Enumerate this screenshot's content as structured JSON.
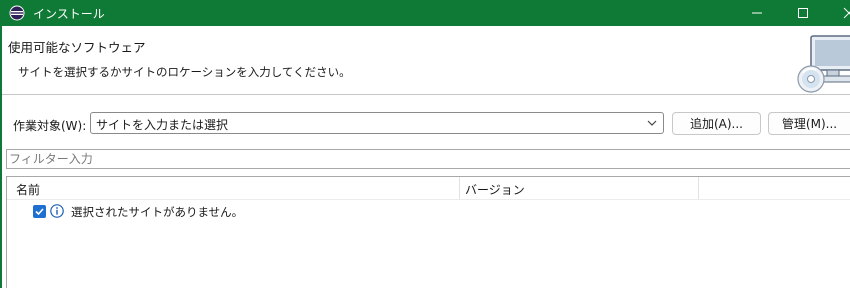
{
  "window": {
    "title": "インストール",
    "icons": {
      "app": "eclipse-icon",
      "minimize": "minimize-icon",
      "maximize": "maximize-icon",
      "close": "close-icon"
    },
    "colors": {
      "titlebar": "#0f7a36",
      "titlebar_text": "#ffffff"
    }
  },
  "banner": {
    "heading": "使用可能なソフトウェア",
    "message": "サイトを選択するかサイトのロケーションを入力してください。",
    "graphic": "computer-cd-install-icon"
  },
  "work_with": {
    "label": "作業対象(W):",
    "combo_value": "サイトを入力または選択",
    "add_button": "追加(A)...",
    "manage_button": "管理(M)..."
  },
  "filter": {
    "placeholder": "フィルター入力",
    "value": ""
  },
  "table": {
    "columns": [
      "名前",
      "バージョン"
    ],
    "rows": [
      {
        "checked": true,
        "icon": "info-icon",
        "name": "選択されたサイトがありません。",
        "version": ""
      }
    ]
  },
  "colors": {
    "checkbox": "#1f6fd1",
    "info_icon": "#1a5fb4"
  }
}
